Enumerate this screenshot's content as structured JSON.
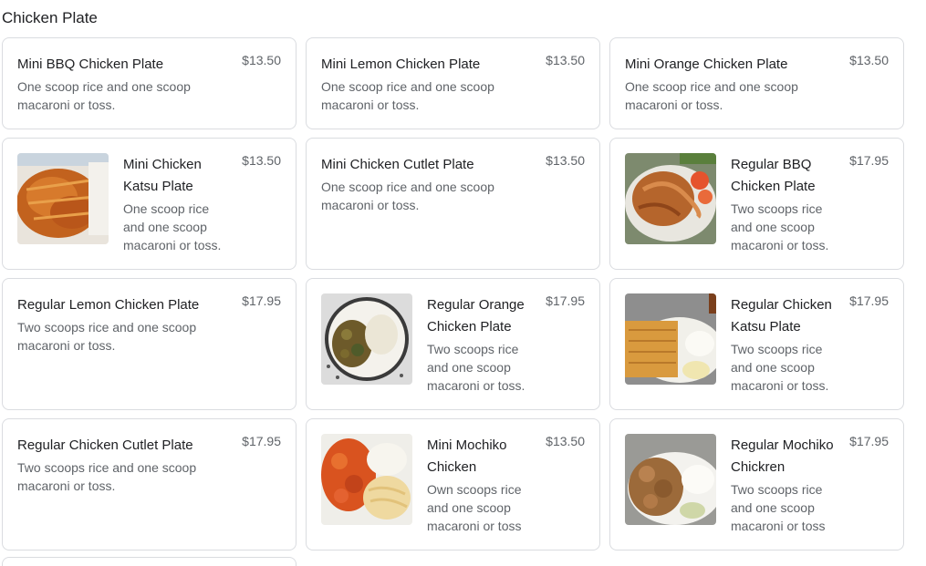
{
  "section": {
    "title": "Chicken Plate"
  },
  "items": [
    {
      "name": "Mini BBQ Chicken Plate",
      "price": "$13.50",
      "desc": "One scoop rice and one scoop macaroni or toss."
    },
    {
      "name": "Mini Lemon Chicken Plate",
      "price": "$13.50",
      "desc": "One scoop rice and one scoop macaroni or toss."
    },
    {
      "name": "Mini Orange Chicken Plate",
      "price": "$13.50",
      "desc": "One scoop rice and one scoop macaroni or toss."
    },
    {
      "name": "Mini Chicken Katsu Plate",
      "price": "$13.50",
      "desc": "One scoop rice and one scoop macaroni or toss."
    },
    {
      "name": "Mini Chicken Cutlet Plate",
      "price": "$13.50",
      "desc": "One scoop rice and one scoop macaroni or toss."
    },
    {
      "name": "Regular BBQ Chicken Plate",
      "price": "$17.95",
      "desc": "Two scoops rice and one scoop macaroni or toss."
    },
    {
      "name": "Regular Lemon Chicken Plate",
      "price": "$17.95",
      "desc": "Two scoops rice and one scoop macaroni or toss."
    },
    {
      "name": "Regular Orange Chicken Plate",
      "price": "$17.95",
      "desc": "Two scoops rice and one scoop macaroni or toss."
    },
    {
      "name": "Regular Chicken Katsu Plate",
      "price": "$17.95",
      "desc": "Two scoops rice and one scoop macaroni or toss."
    },
    {
      "name": "Regular Chicken Cutlet Plate",
      "price": "$17.95",
      "desc": "Two scoops rice and one scoop macaroni or toss."
    },
    {
      "name": "Mini Mochiko Chicken",
      "price": "$13.50",
      "desc": "Own scoops rice and one scoop macaroni or toss"
    },
    {
      "name": "Regular Mochiko Chickren",
      "price": "$17.95",
      "desc": "Two scoops rice and one scoop macaroni or toss"
    }
  ]
}
